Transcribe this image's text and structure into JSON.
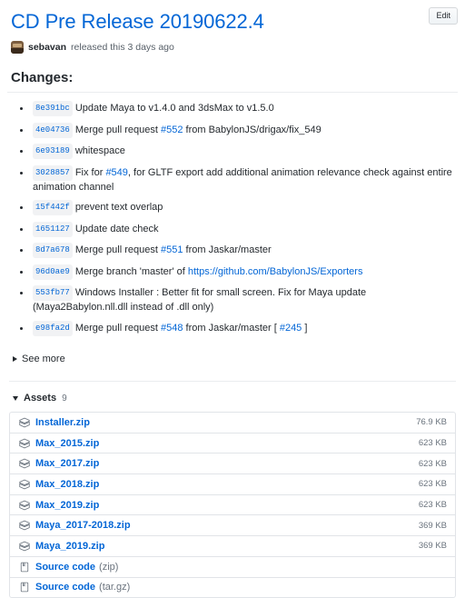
{
  "header": {
    "title": "CD Pre Release 20190622.4",
    "edit_label": "Edit",
    "author": "sebavan",
    "byline_text": "released this 3 days ago",
    "avatar_name": "sebavan-avatar",
    "title_color": "#0366d6"
  },
  "changes": {
    "heading": "Changes:",
    "commits": [
      {
        "sha": "8e391bc",
        "parts": [
          {
            "type": "text",
            "text": "Update Maya to v1.4.0 and 3dsMax to v1.5.0"
          }
        ]
      },
      {
        "sha": "4e04736",
        "parts": [
          {
            "type": "text",
            "text": "Merge pull request "
          },
          {
            "type": "link",
            "text": "#552"
          },
          {
            "type": "text",
            "text": " from BabylonJS/drigax/fix_549"
          }
        ]
      },
      {
        "sha": "6e93189",
        "parts": [
          {
            "type": "text",
            "text": "whitespace"
          }
        ]
      },
      {
        "sha": "3028857",
        "parts": [
          {
            "type": "text",
            "text": "Fix for "
          },
          {
            "type": "link",
            "text": "#549"
          },
          {
            "type": "text",
            "text": ", for GLTF export add additional animation relevance check against entire animation channel"
          }
        ]
      },
      {
        "sha": "15f442f",
        "parts": [
          {
            "type": "text",
            "text": "prevent text overlap"
          }
        ]
      },
      {
        "sha": "1651127",
        "parts": [
          {
            "type": "text",
            "text": "Update date check"
          }
        ]
      },
      {
        "sha": "8d7a678",
        "parts": [
          {
            "type": "text",
            "text": "Merge pull request "
          },
          {
            "type": "link",
            "text": "#551"
          },
          {
            "type": "text",
            "text": " from Jaskar/master"
          }
        ]
      },
      {
        "sha": "96d0ae9",
        "parts": [
          {
            "type": "text",
            "text": "Merge branch 'master' of "
          },
          {
            "type": "link",
            "text": "https://github.com/BabylonJS/Exporters"
          }
        ]
      },
      {
        "sha": "553fb77",
        "parts": [
          {
            "type": "text",
            "text": "Windows Installer : Better fit for small screen. Fix for Maya update (Maya2Babylon.nll.dll instead of .dll only)"
          }
        ]
      },
      {
        "sha": "e98fa2d",
        "parts": [
          {
            "type": "text",
            "text": "Merge pull request "
          },
          {
            "type": "link",
            "text": "#548"
          },
          {
            "type": "text",
            "text": " from Jaskar/master [ "
          },
          {
            "type": "link",
            "text": "#245"
          },
          {
            "type": "text",
            "text": " ]"
          }
        ]
      }
    ],
    "see_more_label": "See more",
    "see_more_icon": "triangle-right-icon"
  },
  "assets": {
    "label": "Assets",
    "count": "9",
    "toggle_icon": "triangle-down-icon",
    "rows": [
      {
        "name": "Installer.zip",
        "suffix": "",
        "size": "76.9 KB",
        "icon": "package-icon"
      },
      {
        "name": "Max_2015.zip",
        "suffix": "",
        "size": "623 KB",
        "icon": "package-icon"
      },
      {
        "name": "Max_2017.zip",
        "suffix": "",
        "size": "623 KB",
        "icon": "package-icon"
      },
      {
        "name": "Max_2018.zip",
        "suffix": "",
        "size": "623 KB",
        "icon": "package-icon"
      },
      {
        "name": "Max_2019.zip",
        "suffix": "",
        "size": "623 KB",
        "icon": "package-icon"
      },
      {
        "name": "Maya_2017-2018.zip",
        "suffix": "",
        "size": "369 KB",
        "icon": "package-icon"
      },
      {
        "name": "Maya_2019.zip",
        "suffix": "",
        "size": "369 KB",
        "icon": "package-icon"
      },
      {
        "name": "Source code",
        "suffix": "(zip)",
        "size": "",
        "icon": "file-zip-icon"
      },
      {
        "name": "Source code",
        "suffix": "(tar.gz)",
        "size": "",
        "icon": "file-zip-icon"
      }
    ]
  }
}
